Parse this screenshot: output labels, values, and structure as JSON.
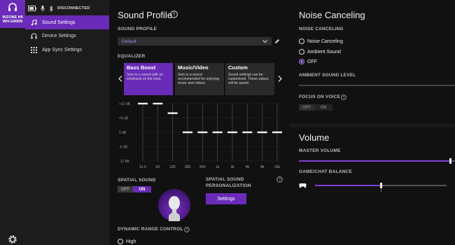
{
  "sidebar": {
    "device_name": "INZONE H9\nWH-G900N",
    "status": "DISCONNECTED",
    "items": [
      {
        "label": "Sound Settings",
        "icon": "music-note-icon",
        "active": true
      },
      {
        "label": "Device Settings",
        "icon": "headphones-icon",
        "active": false
      },
      {
        "label": "App Sync Settings",
        "icon": "app-grid-icon",
        "active": false
      }
    ]
  },
  "sound_profile": {
    "title": "Sound Profile",
    "profile_label": "SOUND PROFILE",
    "selected_profile": "Default",
    "equalizer_label": "EQUALIZER",
    "presets": [
      {
        "title": "Bass Boost",
        "desc": "Sets to a sound with an emphasis on the lows.",
        "active": true
      },
      {
        "title": "Music/Video",
        "desc": "Sets to a sound recommended for enjoying music and videos.",
        "active": false
      },
      {
        "title": "Custom",
        "desc": "Sound settings can be customized. These values will be saved.",
        "active": false
      }
    ],
    "db_labels": [
      "+12 dB",
      "+6 dB",
      "0 dB",
      "-6 dB",
      "-12 dB"
    ],
    "spatial_label": "SPATIAL SOUND",
    "spatial_off": "OFF",
    "spatial_on": "ON",
    "personalization_label": "SPATIAL SOUND PERSONALIZATION",
    "settings_button": "Settings",
    "drc_label": "DYNAMIC RANGE CONTROL",
    "drc_option": "High"
  },
  "chart_data": {
    "type": "bar",
    "categories": [
      "31.5",
      "63",
      "125",
      "250",
      "500",
      "1k",
      "2k",
      "4k",
      "8k",
      "16k"
    ],
    "values": [
      12,
      12,
      8,
      0,
      0,
      0,
      0,
      0,
      0,
      0
    ],
    "ylim": [
      -12,
      12
    ],
    "xlabel": "",
    "ylabel": ""
  },
  "noise_canceling": {
    "title": "Noise Canceling",
    "section_label": "NOISE CANCELING",
    "options": [
      {
        "label": "Noise Canceling",
        "checked": false
      },
      {
        "label": "Ambient Sound",
        "checked": false
      },
      {
        "label": "OFF",
        "checked": true
      }
    ],
    "ambient_level_label": "AMBIENT SOUND LEVEL",
    "focus_label": "FOCUS ON VOICE",
    "focus_off": "OFF",
    "focus_on": "ON"
  },
  "volume": {
    "title": "Volume",
    "master_label": "MASTER VOLUME",
    "master_value": 0.97,
    "balance_label": "GAME/CHAT BALANCE",
    "balance_value": 0.5
  },
  "colors": {
    "accent": "#6a2bb8",
    "accent_light": "#a97ef0"
  }
}
